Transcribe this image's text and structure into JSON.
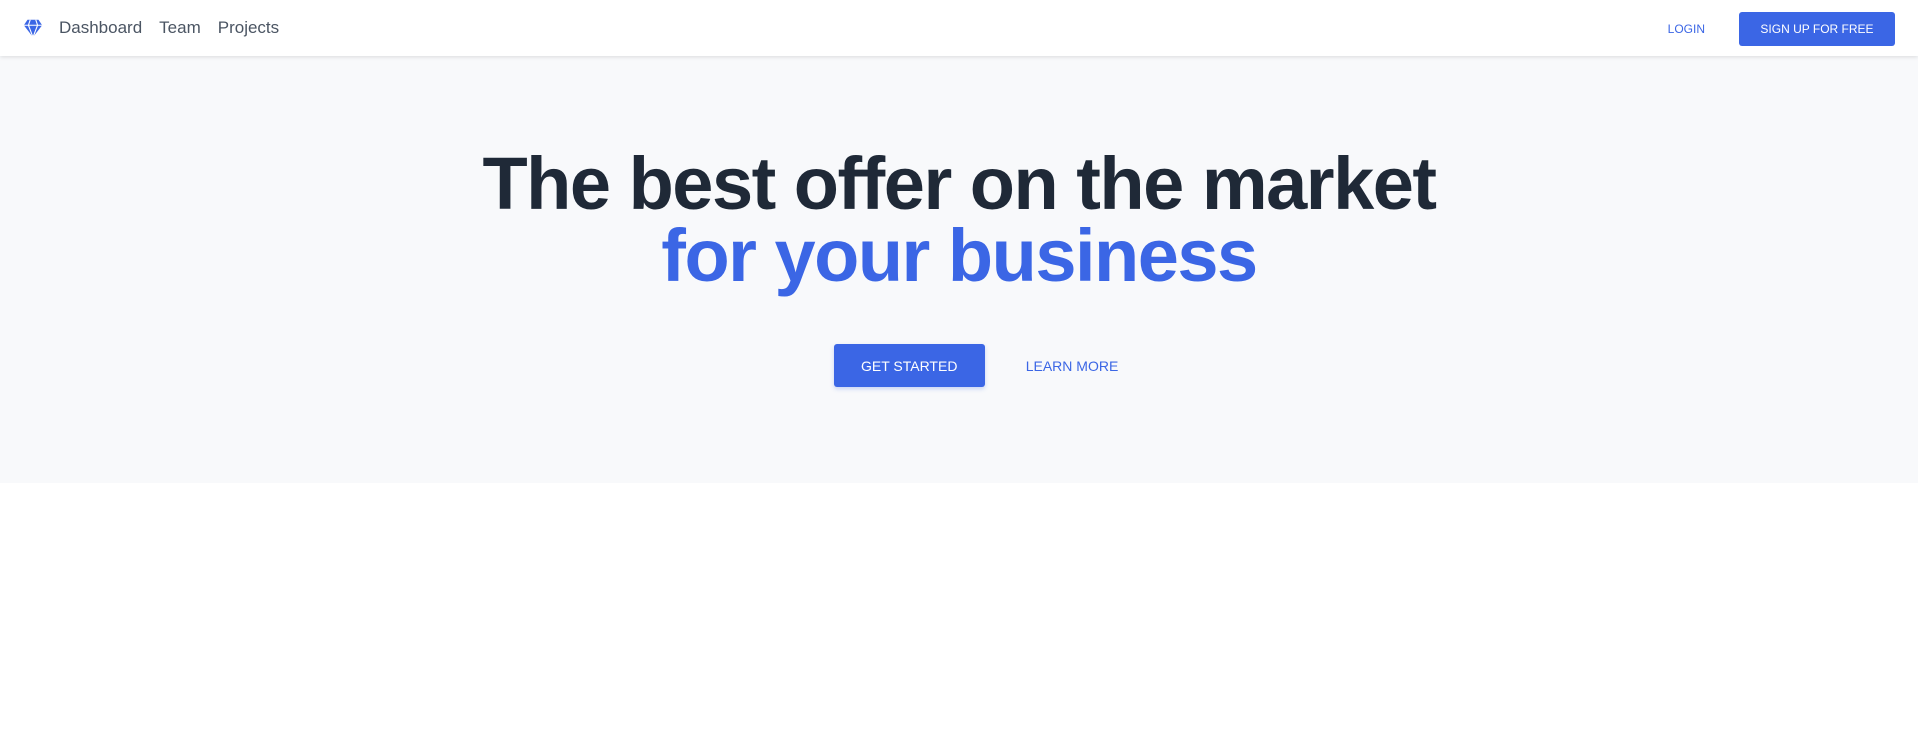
{
  "nav": {
    "logo_icon": "diamond-icon",
    "links": [
      "Dashboard",
      "Team",
      "Projects"
    ],
    "login_label": "LOGIN",
    "signup_label": "SIGN UP FOR FREE"
  },
  "hero": {
    "title_line1": "The best offer on the market",
    "title_line2": "for your business",
    "primary_label": "GET STARTED",
    "secondary_label": "LEARN MORE"
  },
  "colors": {
    "accent": "#3b66e5",
    "heading": "#1f2937",
    "hero_bg": "#f8f9fb"
  }
}
